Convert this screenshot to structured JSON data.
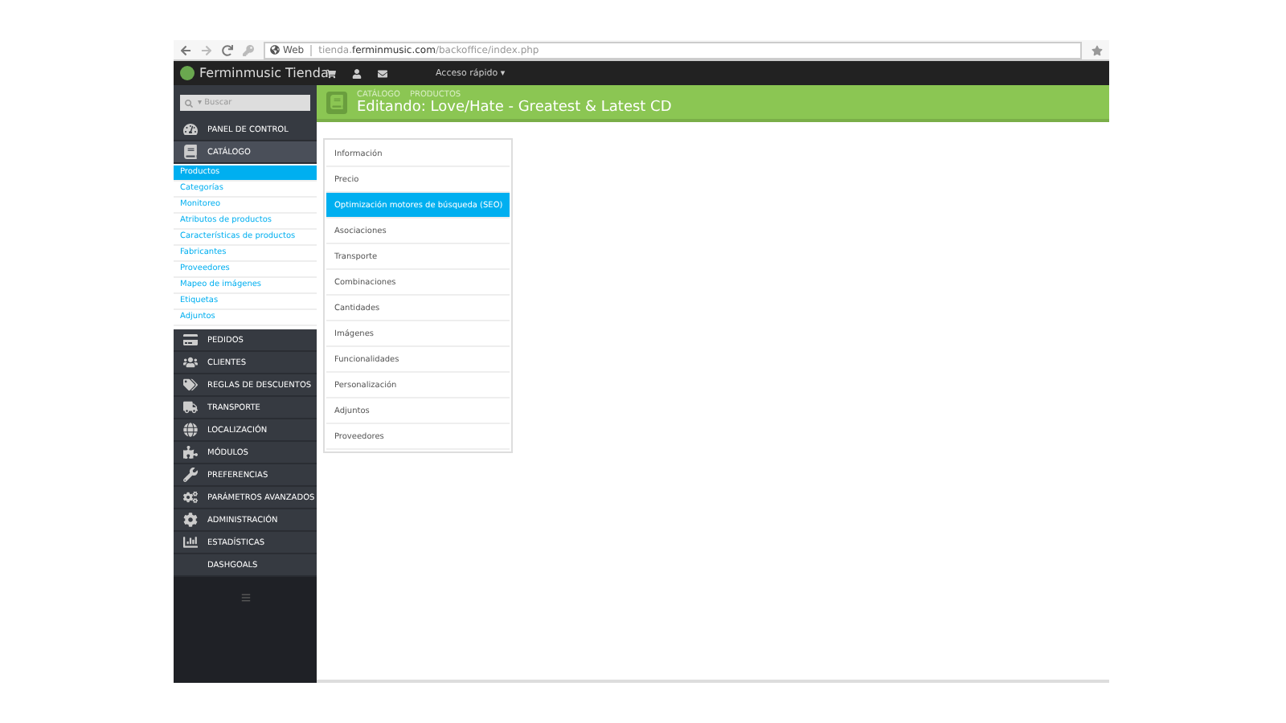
{
  "browser": {
    "site_label": "Web",
    "url": "tienda.**ferminmusic.com**/backoffice/index.php"
  },
  "topbar": {
    "brand": "Ferminmusic Tienda",
    "quick_access": "Acceso rápido ▾"
  },
  "search": {
    "caret": "▾",
    "placeholder": "Buscar"
  },
  "sidebar": {
    "items": [
      {
        "label": "PANEL DE CONTROL",
        "selected": false
      },
      {
        "label": "CATÁLOGO",
        "selected": true,
        "children": [
          {
            "label": "Productos",
            "selected": true
          },
          {
            "label": "Categorías",
            "selected": false
          },
          {
            "label": "Monitoreo",
            "selected": false
          },
          {
            "label": "Atributos de productos",
            "selected": false
          },
          {
            "label": "Características de productos",
            "selected": false
          },
          {
            "label": "Fabricantes",
            "selected": false
          },
          {
            "label": "Proveedores",
            "selected": false
          },
          {
            "label": "Mapeo de imágenes",
            "selected": false
          },
          {
            "label": "Etiquetas",
            "selected": false
          },
          {
            "label": "Adjuntos",
            "selected": false
          }
        ]
      },
      {
        "label": "PEDIDOS",
        "selected": false
      },
      {
        "label": "CLIENTES",
        "selected": false
      },
      {
        "label": "REGLAS DE DESCUENTOS",
        "selected": false
      },
      {
        "label": "TRANSPORTE",
        "selected": false
      },
      {
        "label": "LOCALIZACIÓN",
        "selected": false
      },
      {
        "label": "MÓDULOS",
        "selected": false
      },
      {
        "label": "PREFERENCIAS",
        "selected": false
      },
      {
        "label": "PARÁMETROS AVANZADOS",
        "selected": false
      },
      {
        "label": "ADMINISTRACIÓN",
        "selected": false
      },
      {
        "label": "ESTADÍSTICAS",
        "selected": false
      },
      {
        "label": "DASHGOALS",
        "selected": false
      }
    ]
  },
  "header": {
    "breadcrumb": [
      "CATÁLOGO",
      "PRODUCTOS"
    ],
    "title": "Editando: Love/Hate - Greatest & Latest CD"
  },
  "tabs": [
    {
      "label": "Información",
      "selected": false
    },
    {
      "label": "Precio",
      "selected": false
    },
    {
      "label": "Optimización motores de búsqueda (SEO)",
      "selected": true
    },
    {
      "label": "Asociaciones",
      "selected": false
    },
    {
      "label": "Transporte",
      "selected": false
    },
    {
      "label": "Combinaciones",
      "selected": false
    },
    {
      "label": "Cantidades",
      "selected": false
    },
    {
      "label": "Imágenes",
      "selected": false
    },
    {
      "label": "Funcionalidades",
      "selected": false
    },
    {
      "label": "Personalización",
      "selected": false
    },
    {
      "label": "Adjuntos",
      "selected": false
    },
    {
      "label": "Proveedores",
      "selected": false
    }
  ]
}
